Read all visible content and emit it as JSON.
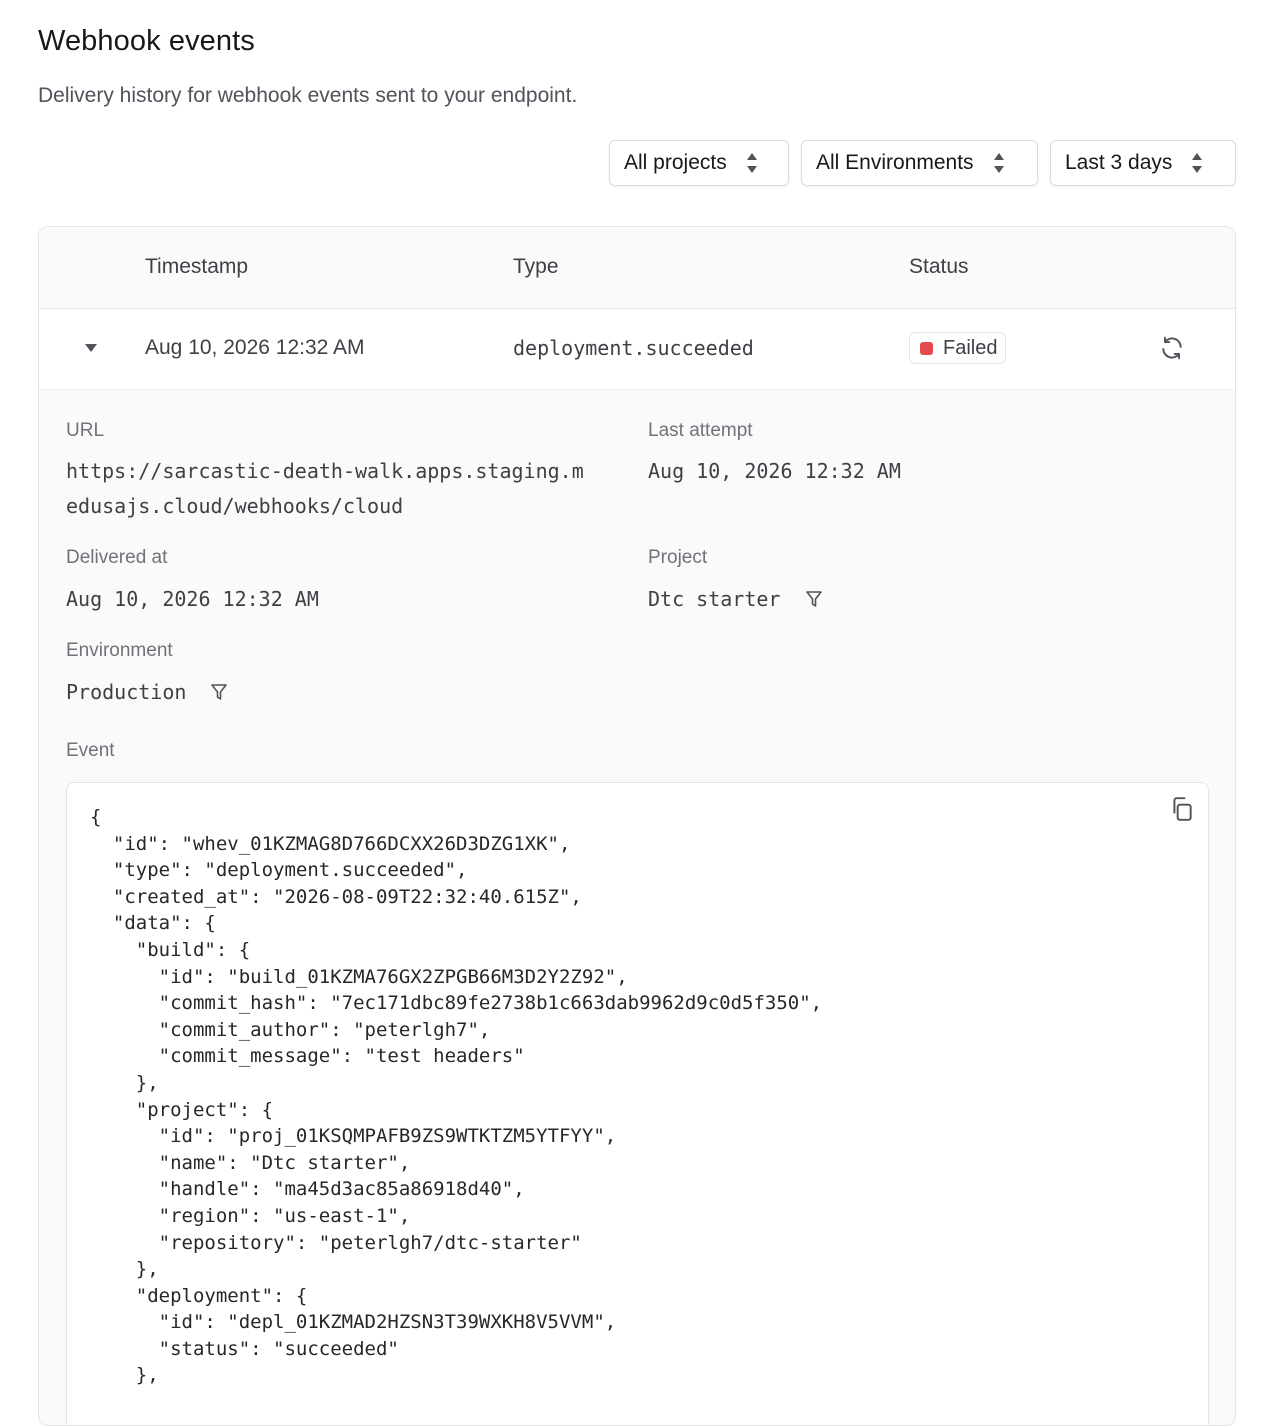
{
  "header": {
    "title": "Webhook events",
    "subtitle": "Delivery history for webhook events sent to your endpoint."
  },
  "filters": {
    "project": "All projects",
    "environment": "All Environments",
    "range": "Last 3 days"
  },
  "table": {
    "columns": {
      "timestamp": "Timestamp",
      "type": "Type",
      "status": "Status"
    },
    "row": {
      "timestamp": "Aug 10, 2026 12:32 AM",
      "type": "deployment.succeeded",
      "status": "Failed",
      "status_color": "#e5484d"
    }
  },
  "details": {
    "url_label": "URL",
    "url_line1": "https://sarcastic-death-walk.apps.staging.m",
    "url_line2": "edusajs.cloud/webhooks/cloud",
    "last_attempt_label": "Last attempt",
    "last_attempt": "Aug 10, 2026 12:32 AM",
    "delivered_label": "Delivered at",
    "delivered": "Aug 10, 2026 12:32 AM",
    "project_label": "Project",
    "project": "Dtc starter",
    "environment_label": "Environment",
    "environment": "Production",
    "event_label": "Event"
  },
  "event_json": "{\n  \"id\": \"whev_01KZMAG8D766DCXX26D3DZG1XK\",\n  \"type\": \"deployment.succeeded\",\n  \"created_at\": \"2026-08-09T22:32:40.615Z\",\n  \"data\": {\n    \"build\": {\n      \"id\": \"build_01KZMA76GX2ZPGB66M3D2Y2Z92\",\n      \"commit_hash\": \"7ec171dbc89fe2738b1c663dab9962d9c0d5f350\",\n      \"commit_author\": \"peterlgh7\",\n      \"commit_message\": \"test headers\"\n    },\n    \"project\": {\n      \"id\": \"proj_01KSQMPAFB9ZS9WTKTZM5YTFYY\",\n      \"name\": \"Dtc starter\",\n      \"handle\": \"ma45d3ac85a86918d40\",\n      \"region\": \"us-east-1\",\n      \"repository\": \"peterlgh7/dtc-starter\"\n    },\n    \"deployment\": {\n      \"id\": \"depl_01KZMAD2HZSN3T39WXKH8V5VVM\",\n      \"status\": \"succeeded\"\n    },",
  "icons": {
    "select_caret": "chevron-up-down-icon",
    "expander": "caret-down-icon",
    "retry": "refresh-icon",
    "filter": "filter-icon",
    "copy": "copy-icon"
  }
}
